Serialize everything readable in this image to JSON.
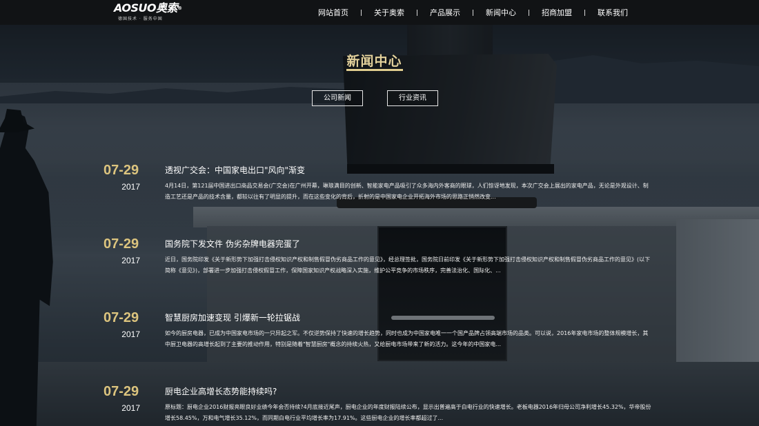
{
  "header": {
    "logo_text": "AOSUO奥索",
    "logo_reg": "®",
    "logo_tagline": "德国技术 · 服务中国",
    "nav": [
      {
        "label": "网站首页"
      },
      {
        "label": "关于奥索"
      },
      {
        "label": "产品展示"
      },
      {
        "label": "新闻中心"
      },
      {
        "label": "招商加盟"
      },
      {
        "label": "联系我们"
      }
    ]
  },
  "section": {
    "title": "新闻中心",
    "tabs": [
      {
        "label": "公司新闻"
      },
      {
        "label": "行业资讯"
      }
    ]
  },
  "news": [
    {
      "date": "07-29",
      "year": "2017",
      "title": "透视广交会：中国家电出口\"风向\"渐变",
      "summary": "4月14日，第121届中国进出口商品交易会(广交会)在广州开幕，琳琅满目的创新、智能家电产品吸引了众多海内外客商的眼球，人们惊讶地发现，本次广交会上展出的家电产品，无论是外观设计、制造工艺还是产品的技术含量，都较以往有了明显的提升，而在这些变化的背后，折射的是中国家电企业开拓海外市场的思路正悄然改变..."
    },
    {
      "date": "07-29",
      "year": "2017",
      "title": "国务院下发文件 伪劣杂牌电器完蛋了",
      "summary": "近日，国务院印发《关于新形势下加强打击侵权知识产权和制售假冒伪劣商品工作的意见》，经总理签批，国务院日前印发《关于新形势下加强打击侵权知识产权和制售假冒伪劣商品工作的意见》(以下简称《意见》)，部署进一步加强打击侵权假冒工作，保障国家知识产权战略深入实施，维护公平竞争的市场秩序，完善法治化、国际化、..."
    },
    {
      "date": "07-29",
      "year": "2017",
      "title": "智慧厨房加速变现 引爆新一轮拉锯战",
      "summary": "如今的厨房电器，已成为中国家电市场的一只异起之军。不仅逆势保持了快速的增长趋势，同时也成为中国家电唯一一个国产品牌占领高端市场的品类。可以说，2016年家电市场的整体规模增长，其中厨卫电器的高增长起到了主要的推动作用，特别是随着\"智慧厨房\"概念的持续火热，又给厨电市场带来了新的活力。这今年的中国家电..."
    },
    {
      "date": "07-29",
      "year": "2017",
      "title": "厨电企业高增长态势能持续吗?",
      "summary": "原标题：厨电企业2016财报亮眼良好业绩今年会否持续?4月底接近尾声，厨电企业的年度财报陆续公布，显示出普遍高于白电行业的快速增长。老板电器2016年归母公司净利增长45.32%，华帝股份增长58.45%，万和电气增长35.12%，而同期白电行业平均增长率为17.91%。这些厨电企业的增长率都超过了..."
    }
  ],
  "colors": {
    "accent_gold": "#dcc47e",
    "header_bg": "#111315"
  }
}
